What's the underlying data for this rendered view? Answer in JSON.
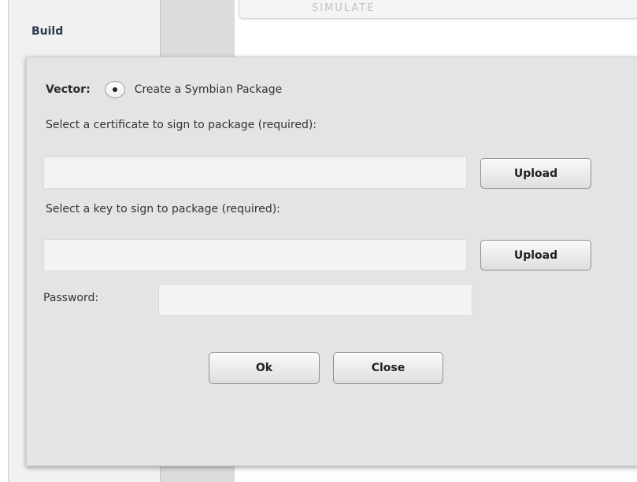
{
  "background": {
    "tab_label": "Build",
    "top_card_label": "SIMULATE"
  },
  "dialog": {
    "vector_label": "Vector:",
    "vector_option": {
      "label": "Create a Symbian Package",
      "selected": true
    },
    "certificate": {
      "label": "Select a certificate to sign to package (required):",
      "value": "",
      "upload_label": "Upload"
    },
    "key": {
      "label": "Select a key to sign to package (required):",
      "value": "",
      "upload_label": "Upload"
    },
    "password": {
      "label": "Password:",
      "value": ""
    },
    "ok_label": "Ok",
    "close_label": "Close"
  },
  "colors": {
    "dialog_bg": "#e4e4e4",
    "field_bg": "#f3f3f3",
    "button_border": "#8f8f8f",
    "tab_text": "#2b3a4a"
  }
}
